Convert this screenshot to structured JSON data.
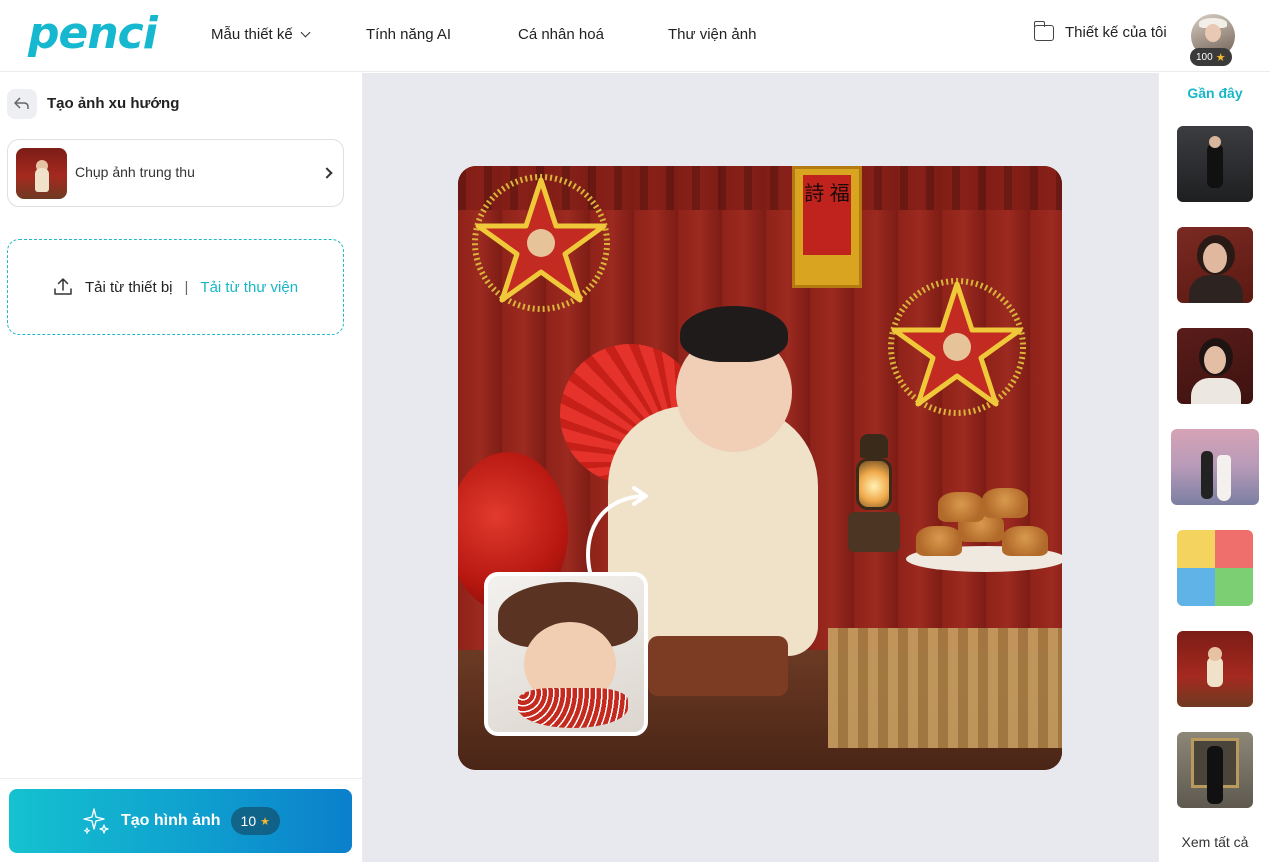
{
  "brand": {
    "logo_text": "penci"
  },
  "nav": {
    "items": [
      {
        "label": "Mẫu thiết kế",
        "has_dropdown": true
      },
      {
        "label": "Tính năng AI"
      },
      {
        "label": "Cá nhân hoá"
      },
      {
        "label": "Thư viện ảnh"
      }
    ],
    "my_designs_label": "Thiết kế của tôi"
  },
  "user": {
    "credits": "100",
    "credit_icon": "star-icon"
  },
  "panel": {
    "title": "Tạo ảnh xu hướng",
    "template_name": "Chụp ảnh trung thu",
    "upload_device_label": "Tải từ thiết bị",
    "upload_separator": "|",
    "upload_library_label": "Tải từ thư viện"
  },
  "generate": {
    "label": "Tạo hình ảnh",
    "cost": "10"
  },
  "preview": {
    "scroll_text": "詩 福"
  },
  "recent": {
    "title": "Gần đây",
    "see_all_label": "Xem tất cả",
    "thumbnails": [
      {
        "name": "recent-thumb-elevator-fashion"
      },
      {
        "name": "recent-thumb-portrait-dark"
      },
      {
        "name": "recent-thumb-portrait-red"
      },
      {
        "name": "recent-thumb-couple-beach"
      },
      {
        "name": "recent-thumb-baby-collage"
      },
      {
        "name": "recent-thumb-mid-autumn"
      },
      {
        "name": "recent-thumb-gallery-frame"
      }
    ]
  },
  "colors": {
    "accent": "#17b7c8",
    "button_gradient_start": "#15c2cf",
    "button_gradient_end": "#0b7fcc",
    "canvas_bg": "#e8e9ee"
  }
}
